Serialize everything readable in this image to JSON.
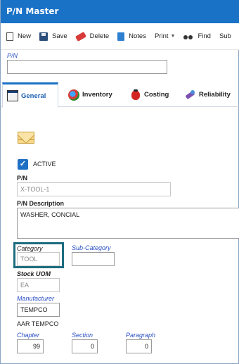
{
  "window": {
    "title": "P/N Master"
  },
  "toolbar": {
    "new": "New",
    "save": "Save",
    "delete": "Delete",
    "notes": "Notes",
    "print": "Print",
    "find": "Find",
    "sub": "Sub"
  },
  "pn_search": {
    "label": "P/N",
    "value": ""
  },
  "tabs": [
    {
      "label": "General"
    },
    {
      "label": "Inventory"
    },
    {
      "label": "Costing"
    },
    {
      "label": "Reliability"
    }
  ],
  "general": {
    "active_label": "ACTIVE",
    "active_checked": true,
    "pn_label": "P/N",
    "pn_value": "X-TOOL-1",
    "description_label": "P/N Description",
    "description_value": "WASHER, CONCIAL",
    "category_label": "Category",
    "category_value": "TOOL",
    "subcategory_label": "Sub-Category",
    "subcategory_value": "",
    "stock_uom_label": "Stock UOM",
    "stock_uom_value": "EA",
    "manufacturer_label": "Manufacturer",
    "manufacturer_value": "TEMPCO",
    "manufacturer_name": "AAR TEMPCO",
    "chapter_label": "Chapter",
    "chapter_value": "99",
    "section_label": "Section",
    "section_value": "0",
    "paragraph_label": "Paragraph",
    "paragraph_value": "0"
  },
  "colors": {
    "titlebar": "#1a72c7",
    "label_blue": "#2a4fc4",
    "highlight": "#1c6c7f"
  }
}
